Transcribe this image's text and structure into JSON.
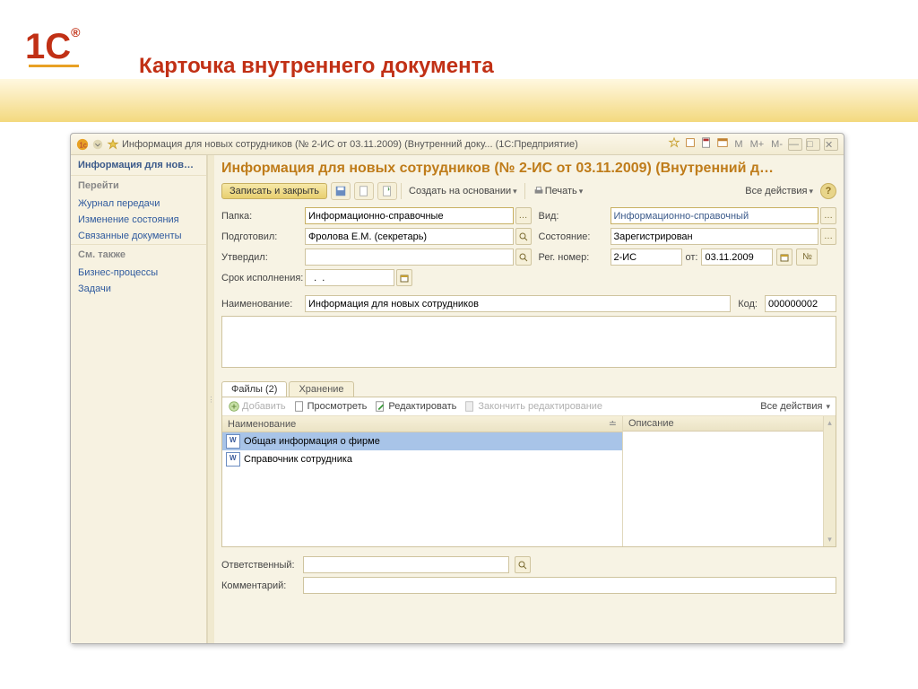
{
  "slide": {
    "logo_text": "1С",
    "reg": "®",
    "title": "Карточка внутреннего документа"
  },
  "window": {
    "title": "Информация для новых сотрудников (№ 2-ИС от 03.11.2009) (Внутренний доку...  (1С:Предприятие)",
    "m1": "М",
    "m2": "М+",
    "m3": "М-"
  },
  "sidebar": {
    "head": "Информация для нов…",
    "go_head": "Перейти",
    "links": [
      "Журнал передачи",
      "Изменение состояния",
      "Связанные документы"
    ],
    "see_head": "См. также",
    "see_links": [
      "Бизнес-процессы",
      "Задачи"
    ]
  },
  "main": {
    "title": "Информация для новых сотрудников (№ 2-ИС от 03.11.2009) (Внутренний д…"
  },
  "toolbar": {
    "save_close": "Записать и закрыть",
    "create_based": "Создать на основании",
    "print": "Печать",
    "all_actions": "Все действия"
  },
  "labels": {
    "folder": "Папка:",
    "prepared": "Подготовил:",
    "approved": "Утвердил:",
    "due": "Срок исполнения:",
    "kind": "Вид:",
    "state": "Состояние:",
    "regnum": "Рег. номер:",
    "from": "от:",
    "num_btn": "№",
    "name": "Наименование:",
    "code": "Код:",
    "responsible": "Ответственный:",
    "comment": "Комментарий:"
  },
  "values": {
    "folder": "Информационно-справочные",
    "prepared": "Фролова Е.М. (секретарь)",
    "approved": "",
    "due": "  .  .",
    "kind": "Информационно-справочный",
    "state": "Зарегистрирован",
    "regnum": "2-ИС",
    "date": "03.11.2009",
    "name": "Информация для новых сотрудников",
    "code": "000000002",
    "responsible": "",
    "comment": ""
  },
  "tabs": {
    "files": "Файлы (2)",
    "storage": "Хранение"
  },
  "files_toolbar": {
    "add": "Добавить",
    "view": "Просмотреть",
    "edit": "Редактировать",
    "finish": "Закончить редактирование",
    "all": "Все действия"
  },
  "files_table": {
    "col_name": "Наименование",
    "col_desc": "Описание",
    "rows": [
      "Общая информация о фирме",
      "Справочник сотрудника"
    ]
  }
}
